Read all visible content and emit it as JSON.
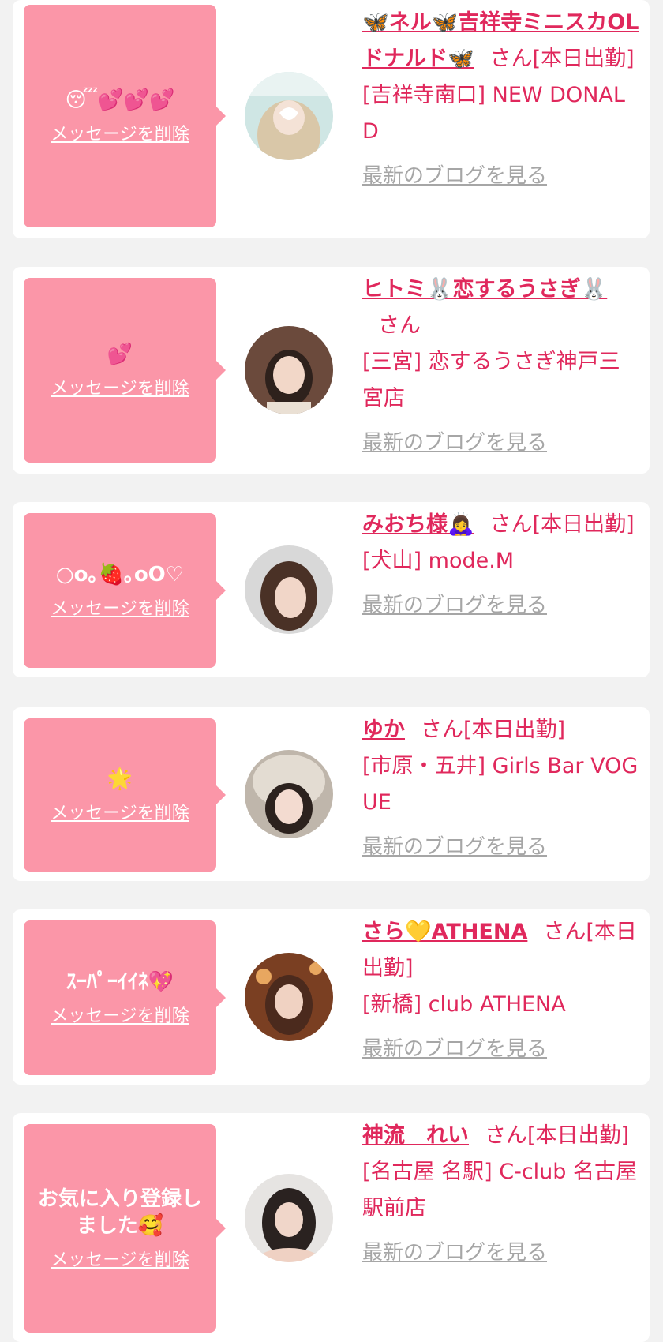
{
  "colors": {
    "accent": "#e0285c",
    "bubble": "#fb96a8",
    "background": "#f2f2f2",
    "muted": "#a6a6a6"
  },
  "cards": [
    {
      "message": "😴💕💕💕",
      "delete_label": "メッセージを削除",
      "name": "🦋ネル🦋吉祥寺ミニスカOLドナルド🦋",
      "suffix": "さん[本日出勤]",
      "shop": "[吉祥寺南口] NEW DONALD",
      "blog_label": "最新のブログを見る"
    },
    {
      "message": "💕",
      "delete_label": "メッセージを削除",
      "name": "ヒトミ🐰恋するうさぎ🐰",
      "suffix": "さん",
      "shop": "[三宮] 恋するうさぎ神戸三宮店",
      "blog_label": "最新のブログを見る"
    },
    {
      "message": "○o｡🍓｡oO♡",
      "delete_label": "メッセージを削除",
      "name": "みおち様🙇‍♀️",
      "suffix": "さん[本日出勤]",
      "shop": "[犬山] mode.M",
      "blog_label": "最新のブログを見る"
    },
    {
      "message": "🌟",
      "delete_label": "メッセージを削除",
      "name": "ゆか",
      "suffix": "さん[本日出勤]",
      "shop": "[市原・五井] Girls Bar VOGUE",
      "blog_label": "最新のブログを見る"
    },
    {
      "message": "ｽｰﾊﾟｰｲｲﾈ💖",
      "delete_label": "メッセージを削除",
      "name": "さら💛ATHENA",
      "suffix": "さん[本日出勤]",
      "shop": "[新橋] club ATHENA",
      "blog_label": "最新のブログを見る"
    },
    {
      "message": "お気に入り登録しました🥰",
      "delete_label": "メッセージを削除",
      "name": "神流　れい",
      "suffix": "さん[本日出勤]",
      "shop": "[名古屋 名駅] C-club 名古屋駅前店",
      "blog_label": "最新のブログを見る"
    }
  ]
}
